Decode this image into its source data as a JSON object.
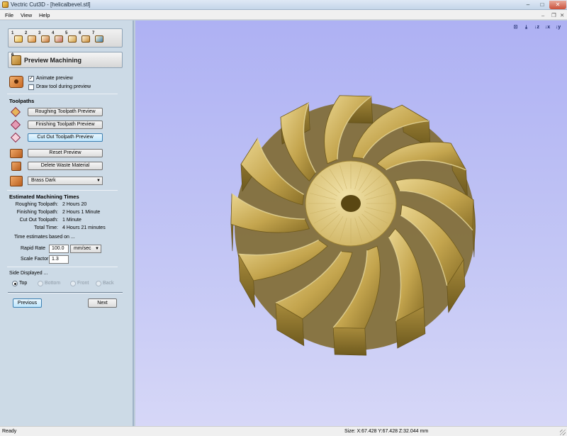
{
  "window": {
    "title": "Vectric Cut3D - [helicalbevel.stl]"
  },
  "menu": {
    "file": "File",
    "view": "View",
    "help": "Help"
  },
  "toolbar": {
    "icons": [
      {
        "number": "1",
        "name": "open-file-icon",
        "color": "#e7b640"
      },
      {
        "number": "2",
        "name": "orientation-icon",
        "color": "#d98a3a"
      },
      {
        "number": "3",
        "name": "model-size-icon",
        "color": "#c8763c"
      },
      {
        "number": "4",
        "name": "roughing-icon",
        "color": "#c06a66"
      },
      {
        "number": "5",
        "name": "finishing-icon",
        "color": "#d2a04a"
      },
      {
        "number": "6",
        "name": "preview-icon",
        "color": "#c98b3a"
      },
      {
        "number": "7",
        "name": "save-toolpath-icon",
        "color": "#3c7fb1"
      }
    ]
  },
  "panel": {
    "step_number": "6",
    "title": "Preview Machining",
    "animate_preview": {
      "label": "Animate preview",
      "checked": true
    },
    "draw_tool": {
      "label": "Draw tool during preview",
      "checked": false
    },
    "toolpaths_heading": "Toolpaths",
    "buttons": {
      "roughing": "Roughing Toolpath Preview",
      "finishing": "Finishing Toolpath Preview",
      "cutout": "Cut Out Toolpath Preview",
      "reset": "Reset Preview",
      "delete_waste": "Delete Waste Material"
    },
    "material_select": "Brass Dark",
    "times_heading": "Estimated Machining Times",
    "times": [
      {
        "label": "Roughing Toolpath:",
        "value": "2 Hours 20"
      },
      {
        "label": "Finishing Toolpath:",
        "value": "2 Hours 1 Minute"
      },
      {
        "label": "Cut Out Toolpath:",
        "value": "1 Minute"
      },
      {
        "label": "Total Time:",
        "value": "4 Hours 21 minutes"
      }
    ],
    "estimates_note": "Time estimates based on ...",
    "rapid_rate": {
      "label": "Rapid Rate",
      "value": "100.0",
      "unit": "mm/sec"
    },
    "scale_factor": {
      "label": "Scale Factor",
      "value": "1.3"
    },
    "side_heading": "Side Displayed ...",
    "sides": [
      {
        "label": "Top",
        "selected": true,
        "enabled": true
      },
      {
        "label": "Bottom",
        "selected": false,
        "enabled": false
      },
      {
        "label": "Front",
        "selected": false,
        "enabled": false
      },
      {
        "label": "Back",
        "selected": false,
        "enabled": false
      }
    ],
    "previous": "Previous",
    "next": "Next"
  },
  "view_tools": [
    {
      "label": "⊡",
      "name": "zoom-all-icon"
    },
    {
      "label": "⤓",
      "name": "iso-view-icon"
    },
    {
      "label": "↓z",
      "name": "view-z-icon"
    },
    {
      "label": "↓x",
      "name": "view-x-icon"
    },
    {
      "label": "↓y",
      "name": "view-y-icon"
    }
  ],
  "status": {
    "left": "Ready",
    "coords": "Size: X:67.428 Y:67.428 Z:32.044 mm"
  },
  "colors": {
    "viewport_bg": "#b7baf4",
    "gear_base": "#c9ac55",
    "gear_light": "#e8d28a",
    "gear_dark": "#7a6322"
  }
}
